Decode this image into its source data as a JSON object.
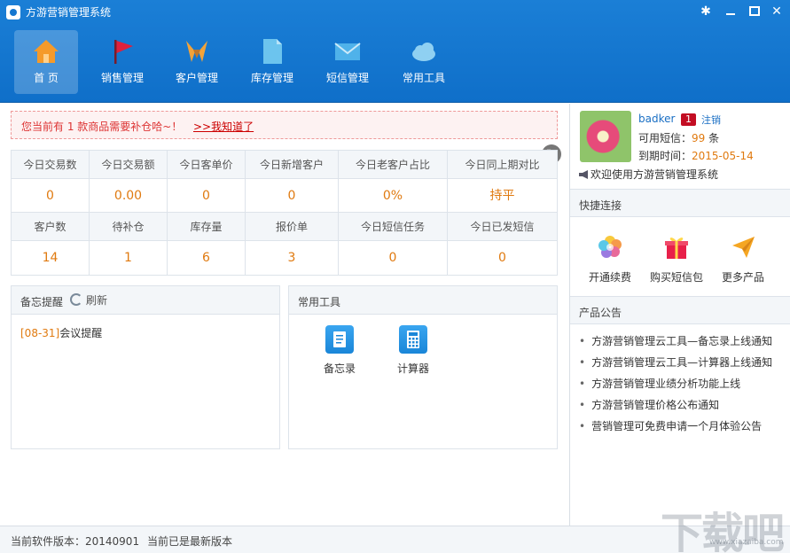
{
  "window": {
    "title": "方游营销管理系统"
  },
  "nav": [
    {
      "label": "首 页",
      "icon": "home-icon"
    },
    {
      "label": "销售管理",
      "icon": "flag-icon"
    },
    {
      "label": "客户管理",
      "icon": "handshake-icon"
    },
    {
      "label": "库存管理",
      "icon": "document-icon"
    },
    {
      "label": "短信管理",
      "icon": "envelope-icon"
    },
    {
      "label": "常用工具",
      "icon": "cloud-icon"
    }
  ],
  "notice": {
    "text": "您当前有 1 款商品需要补仓哈~！",
    "link": ">>我知道了"
  },
  "stats": {
    "row1_labels": [
      "今日交易数",
      "今日交易额",
      "今日客单价",
      "今日新增客户",
      "今日老客户占比",
      "今日同上期对比"
    ],
    "row1_values": [
      "0",
      "0.00",
      "0",
      "0",
      "0%",
      "持平"
    ],
    "row2_labels": [
      "客户数",
      "待补仓",
      "库存量",
      "报价单",
      "今日短信任务",
      "今日已发短信"
    ],
    "row2_values": [
      "14",
      "1",
      "6",
      "3",
      "0",
      "0"
    ]
  },
  "memo": {
    "title": "备忘提醒",
    "refresh": "刷新",
    "item_date": "[08-31]",
    "item_text": "会议提醒"
  },
  "tools": {
    "title": "常用工具",
    "memo_label": "备忘录",
    "calc_label": "计算器"
  },
  "user": {
    "name": "badker",
    "badge": "1",
    "logout": "注销",
    "sms_label": "可用短信：",
    "sms_value": "99",
    "sms_unit": " 条",
    "expire_label": "到期时间：",
    "expire_value": "2015-05-14",
    "welcome": "欢迎使用方游营销管理系统"
  },
  "quick": {
    "title": "快捷连接",
    "items": [
      {
        "label": "开通续费",
        "icon": "colorful-flower-icon"
      },
      {
        "label": "购买短信包",
        "icon": "gift-icon"
      },
      {
        "label": "更多产品",
        "icon": "paper-plane-icon"
      }
    ]
  },
  "announcements": {
    "title": "产品公告",
    "items": [
      "方游营销管理云工具—备忘录上线通知",
      "方游营销管理云工具—计算器上线通知",
      "方游营销管理业绩分析功能上线",
      "方游营销管理价格公布通知",
      "营销管理可免费申请一个月体验公告"
    ]
  },
  "status": {
    "version": "当前软件版本：20140901",
    "latest": "当前已是最新版本"
  },
  "watermark": {
    "main": "下载吧",
    "sub": "www.xiazaiba.com"
  },
  "colors": {
    "header": "#1577d0",
    "accent": "#e07a10",
    "link": "#1a6fc4",
    "alert": "#d33333"
  }
}
